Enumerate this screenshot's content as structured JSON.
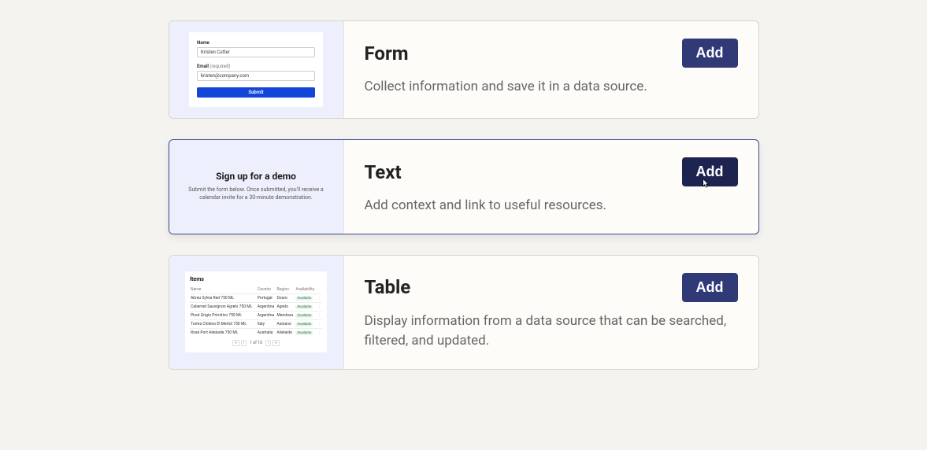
{
  "components": {
    "form": {
      "title": "Form",
      "description": "Collect information and save it in a data source.",
      "add_label": "Add",
      "thumbnail": {
        "name_label": "Name",
        "name_value": "Kristen Cutter",
        "email_label": "Email",
        "email_required": "(required)",
        "email_value": "kristen@company.com",
        "submit_label": "Submit"
      }
    },
    "text": {
      "title": "Text",
      "description": "Add context and link to useful resources.",
      "add_label": "Add",
      "thumbnail": {
        "heading": "Sign up for a demo",
        "body": "Submit the form below. Once submitted, you'll receive a calendar invite for a 30-minute demonstration."
      }
    },
    "table": {
      "title": "Table",
      "description": "Display information from a data source that can be searched, filtered, and updated.",
      "add_label": "Add",
      "thumbnail": {
        "heading": "Items",
        "columns": [
          "Name",
          "Country",
          "Region",
          "Availability",
          ""
        ],
        "rows": [
          [
            "Abreu Sylvia Red 750 ML",
            "Portugal",
            "Douro",
            "Available",
            "⋮"
          ],
          [
            "Cabernet Sauvignon Agrelo 750 ML",
            "Argentina",
            "Agrelo",
            "Available",
            "⋮"
          ],
          [
            "Pinot Grigio Primitivo 750 ML",
            "Argentina",
            "Mendoza",
            "Available",
            "⋮"
          ],
          [
            "Torres Chileno El Merlot 750 ML",
            "Italy",
            "Asolano",
            "Available",
            "⋮"
          ],
          [
            "Rosé Port Adelaide 750 ML",
            "Australia",
            "Adelaide",
            "Available",
            "⋮"
          ]
        ],
        "pager": {
          "leftleft": "«",
          "left": "‹",
          "label": "1 of 10",
          "right": "›",
          "rightright": "»"
        }
      }
    }
  },
  "colors": {
    "button_bg": "#2f3a77",
    "button_bg_hover": "#1d2450",
    "page_bg": "#f5f3ef",
    "thumb_bg": "#edeffc"
  }
}
